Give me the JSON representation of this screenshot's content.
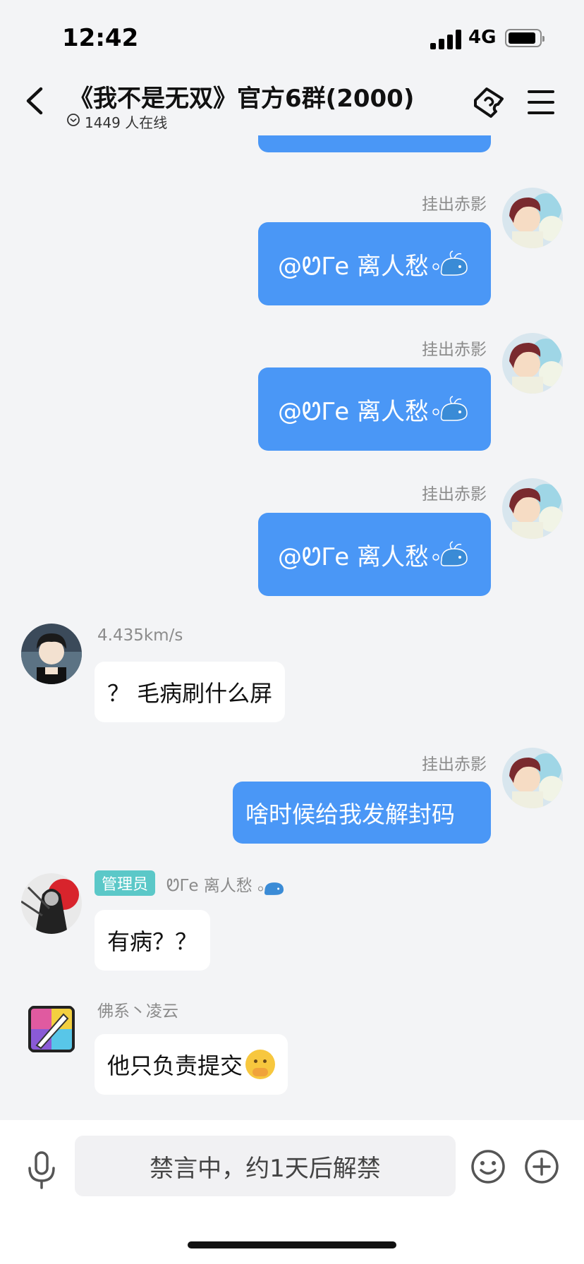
{
  "status_bar": {
    "time": "12:42",
    "network": "4G"
  },
  "header": {
    "title": "《我不是无双》官方6群(2000)",
    "online": "1449 人在线"
  },
  "messages": [
    {
      "direction": "out",
      "sender": "挂出赤影",
      "text": "@ᏬΓе 离人愁"
    },
    {
      "direction": "out",
      "sender": "挂出赤影",
      "text": "@ᏬΓе 离人愁"
    },
    {
      "direction": "out",
      "sender": "挂出赤影",
      "text": "@ᏬΓе 离人愁"
    },
    {
      "direction": "in",
      "sender": "4.435km/s",
      "text": "？ 毛病刷什么屏"
    },
    {
      "direction": "out",
      "sender": "挂出赤影",
      "text": "啥时候给我发解封码"
    },
    {
      "direction": "in",
      "badge": "管理员",
      "sender": "ᏬΓе 离人愁",
      "text": "有病？？"
    },
    {
      "direction": "in",
      "sender": "佛系丶凌云",
      "text": "他只负责提交"
    }
  ],
  "input": {
    "muted_text": "禁言中，约1天后解禁"
  },
  "colors": {
    "outgoing_bubble": "#4a97f6",
    "incoming_bubble": "#ffffff",
    "admin_badge": "#5bc8c8",
    "background": "#f3f4f6"
  },
  "icons": [
    "back-icon",
    "clock-icon",
    "ticket-icon",
    "menu-icon",
    "mic-icon",
    "emoji-icon",
    "plus-icon"
  ]
}
